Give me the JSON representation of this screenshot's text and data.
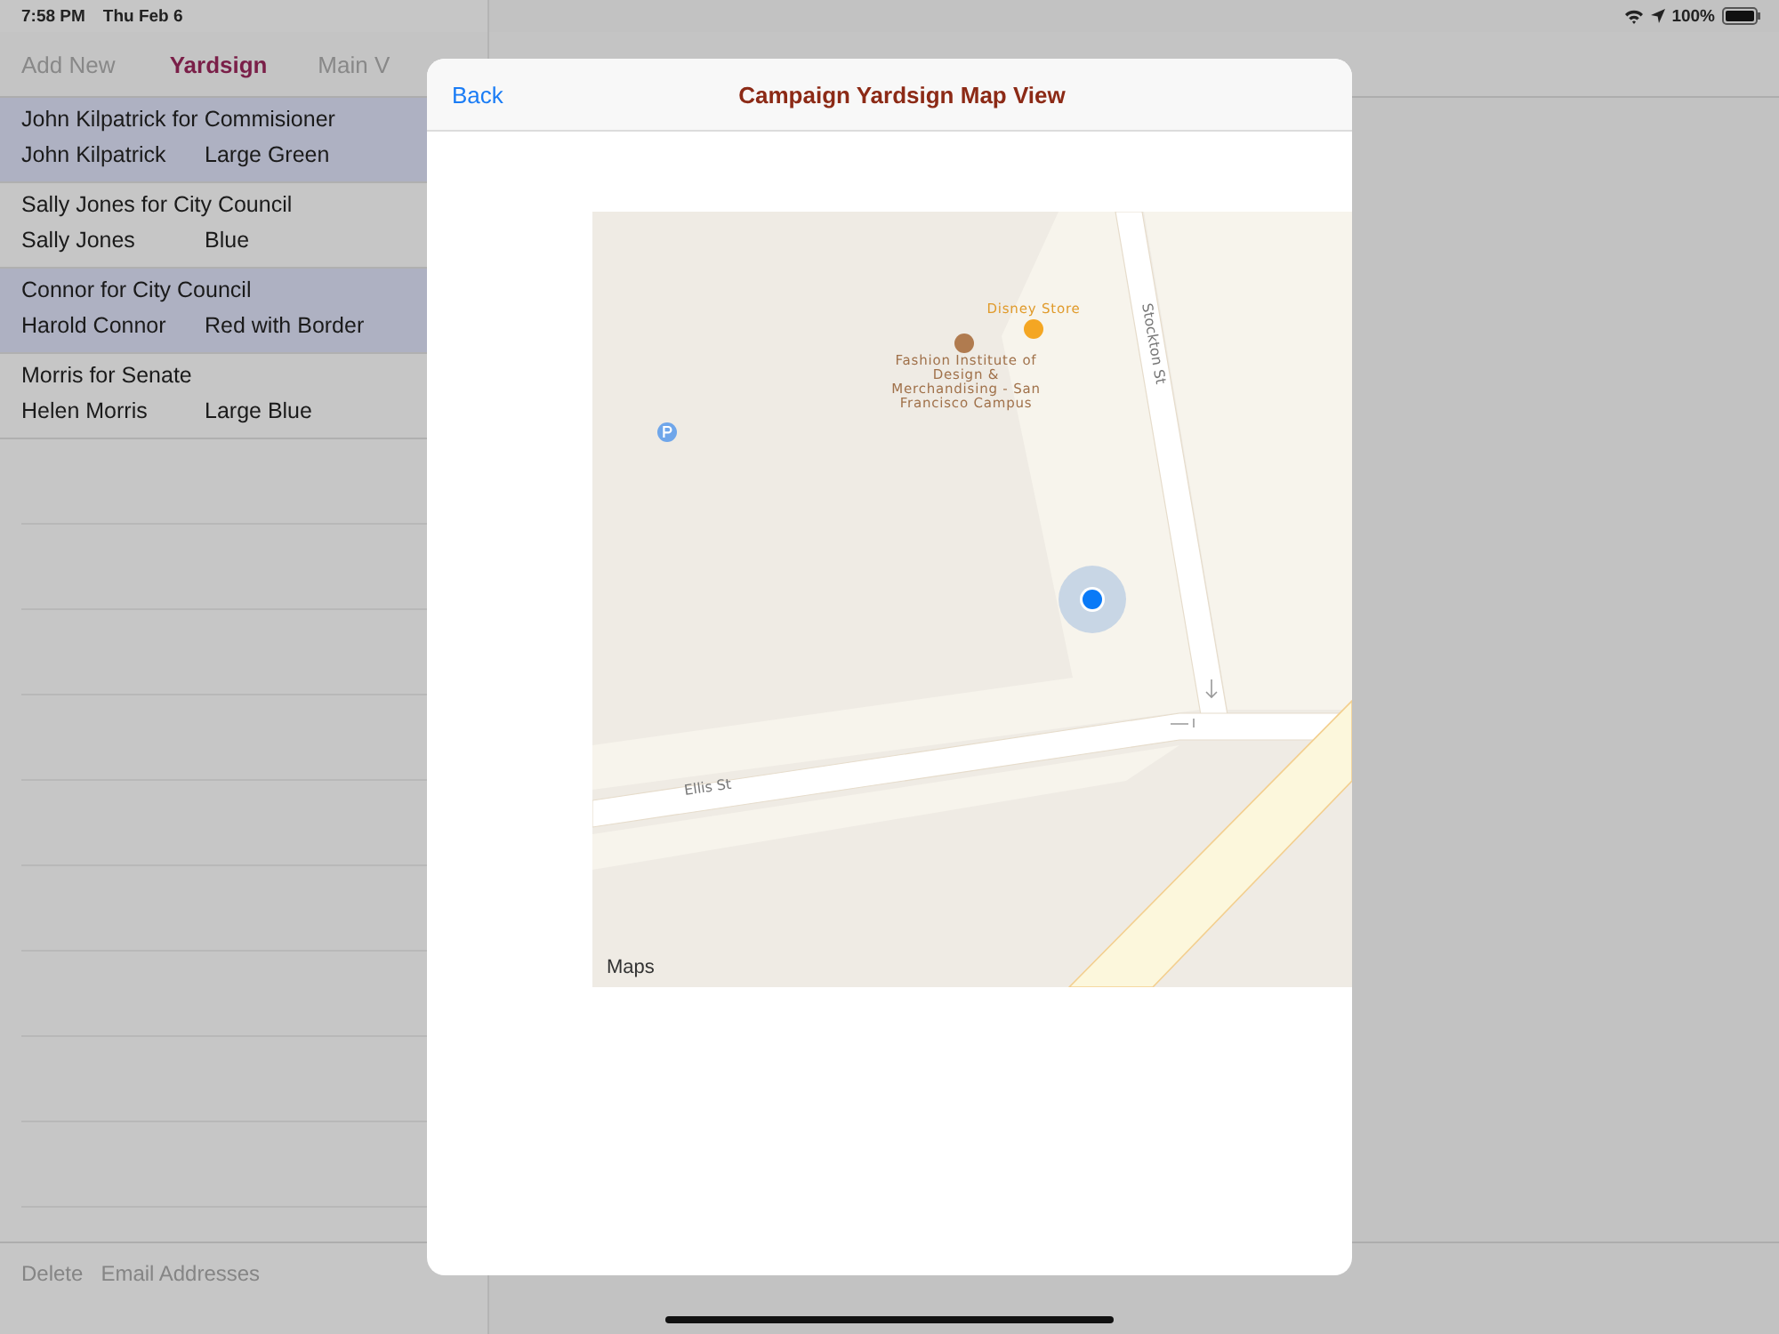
{
  "status_bar": {
    "time": "7:58 PM",
    "date": "Thu Feb 6",
    "battery": "100%"
  },
  "master": {
    "tabs": [
      {
        "label": "Add New",
        "selected": false
      },
      {
        "label": "Yardsign",
        "selected": true
      },
      {
        "label": "Main V",
        "selected": false
      }
    ],
    "rows": [
      {
        "title": "John Kilpatrick for Commisioner",
        "name": "John Kilpatrick",
        "sign": "Large Green",
        "highlighted": true
      },
      {
        "title": "Sally Jones for City Council",
        "name": "Sally Jones",
        "sign": "Blue",
        "highlighted": false
      },
      {
        "title": "Connor for City Council",
        "name": "Harold Connor",
        "sign": "Red with Border",
        "highlighted": true
      },
      {
        "title": "Morris for Senate",
        "name": "Helen Morris",
        "sign": "Large Blue",
        "highlighted": false
      }
    ],
    "toolbar": [
      "Delete",
      "Email Addresses"
    ]
  },
  "modal": {
    "back": "Back",
    "title": "Campaign Yardsign Map View",
    "map": {
      "labels": [
        {
          "kind": "store",
          "text": "Disney Store"
        },
        {
          "kind": "school",
          "text": "Fashion Institute of Design & Merchandising - San Francisco Campus"
        },
        {
          "kind": "street_vertical",
          "text": "Stockton St"
        },
        {
          "kind": "street_horizontal",
          "text": "Ellis St"
        }
      ],
      "attribution": "Maps"
    }
  }
}
